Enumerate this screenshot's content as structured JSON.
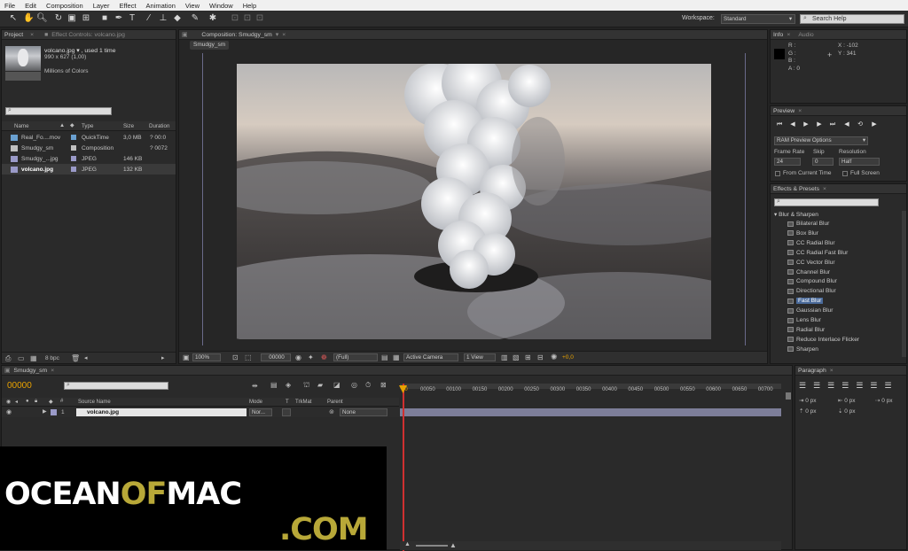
{
  "menu": [
    "File",
    "Edit",
    "Composition",
    "Layer",
    "Effect",
    "Animation",
    "View",
    "Window",
    "Help"
  ],
  "workspace": {
    "label": "Workspace:",
    "value": "Standard",
    "search_placeholder": "Search Help"
  },
  "project": {
    "tab": "Project",
    "effect_controls_tab": "Effect Controls: volcano.jpg",
    "file_name": "volcano.jpg ▾ , used 1 time",
    "file_dims": "990 x 627 (1,00)",
    "file_colors": "Millions of Colors",
    "columns": {
      "name": "Name",
      "type": "Type",
      "size": "Size",
      "duration": "Duration"
    },
    "items": [
      {
        "name": "Real_Fo....mov",
        "type": "QuickTime",
        "size": "3,0 MB",
        "duration": "? 00:0",
        "icon_color": "#6aa0d0"
      },
      {
        "name": "Smudgy_sm",
        "type": "Composition",
        "size": "",
        "duration": "? 0072",
        "icon_color": "#c0c0c0"
      },
      {
        "name": "Smudgy_...jpg",
        "type": "JPEG",
        "size": "146 KB",
        "duration": "",
        "icon_color": "#9a9ac8"
      },
      {
        "name": "volcano.jpg",
        "type": "JPEG",
        "size": "132 KB",
        "duration": "",
        "icon_color": "#9a9ac8"
      }
    ],
    "bpc": "8 bpc"
  },
  "comp": {
    "tab": "Composition: Smudgy_sm",
    "subtab": "Smudgy_sm",
    "zoom": "100%",
    "timecode": "00000",
    "resolution": "(Full)",
    "camera": "Active Camera",
    "view": "1 View",
    "exposure": "+0,0"
  },
  "info": {
    "tab": "Info",
    "audio_tab": "Audio",
    "r": "R :",
    "g": "G :",
    "b": "B :",
    "a": "A : 0",
    "x": "X : -102",
    "y": "Y : 341"
  },
  "preview": {
    "tab": "Preview",
    "ram_options": "RAM Preview Options",
    "frame_rate_label": "Frame Rate",
    "skip_label": "Skip",
    "resolution_label": "Resolution",
    "frame_rate": "24",
    "skip": "0",
    "resolution": "Half",
    "from_current": "From Current Time",
    "full_screen": "Full Screen"
  },
  "effects": {
    "tab": "Effects & Presets",
    "category": "▾ Blur & Sharpen",
    "items": [
      "Bilateral Blur",
      "Box Blur",
      "CC Radial Blur",
      "CC Radial Fast Blur",
      "CC Vector Blur",
      "Channel Blur",
      "Compound Blur",
      "Directional Blur",
      "Fast Blur",
      "Gaussian Blur",
      "Lens Blur",
      "Radial Blur",
      "Reduce Interlace Flicker",
      "Sharpen"
    ],
    "selected": "Fast Blur"
  },
  "timeline": {
    "tab": "Smudgy_sm",
    "timecode": "00000",
    "source_name_col": "Source Name",
    "mode_col": "Mode",
    "t_col": "T",
    "trkmat_col": "TrkMat",
    "parent_col": "Parent",
    "layer": {
      "index": "1",
      "name": "volcano.jpg",
      "mode": "Nor...",
      "parent": "None"
    },
    "ticks": [
      "00050",
      "00100",
      "00150",
      "00200",
      "00250",
      "00300",
      "00350",
      "00400",
      "00450",
      "00500",
      "00550",
      "00600",
      "00650",
      "00700"
    ],
    "zero_tick": "00"
  },
  "paragraph": {
    "tab": "Paragraph",
    "px": "0 px"
  },
  "watermark": {
    "part1": "OCEAN",
    "part2": "OF",
    "part3": "MAC",
    "part4": ".COM"
  },
  "colors": {
    "accent": "#e8a200",
    "watermark_gold": "#b8a838",
    "selection": "#4a6a9a"
  }
}
